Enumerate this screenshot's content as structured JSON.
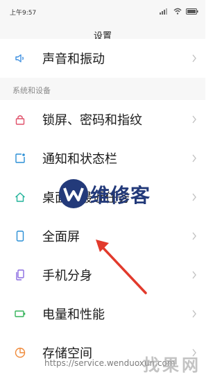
{
  "status_bar": {
    "time": "上午9:57"
  },
  "header": {
    "title": "设置"
  },
  "section": {
    "title": "系统和设备"
  },
  "rows": [
    {
      "label": "声音和振动",
      "icon": "speaker-icon",
      "color": "#3d8fe0"
    },
    {
      "label": "锁屏、密码和指纹",
      "icon": "lock-icon",
      "color": "#e0506a"
    },
    {
      "label": "通知和状态栏",
      "icon": "notification-icon",
      "color": "#2a8fd6"
    },
    {
      "label": "桌面与最近任务",
      "icon": "home-icon",
      "color": "#22b39a"
    },
    {
      "label": "全面屏",
      "icon": "phone-icon",
      "color": "#2a8fd6"
    },
    {
      "label": "手机分身",
      "icon": "dual-phone-icon",
      "color": "#8a6ae0"
    },
    {
      "label": "电量和性能",
      "icon": "battery-icon",
      "color": "#35b35a"
    },
    {
      "label": "存储空间",
      "icon": "storage-icon",
      "color": "#f08a3a"
    }
  ],
  "watermark": {
    "text": "维修客",
    "url": "https://service.wenduoxun.com",
    "brand": "找果网"
  },
  "colors": {
    "arrow": "#e23a2c",
    "chevron": "#c2c2c2"
  }
}
